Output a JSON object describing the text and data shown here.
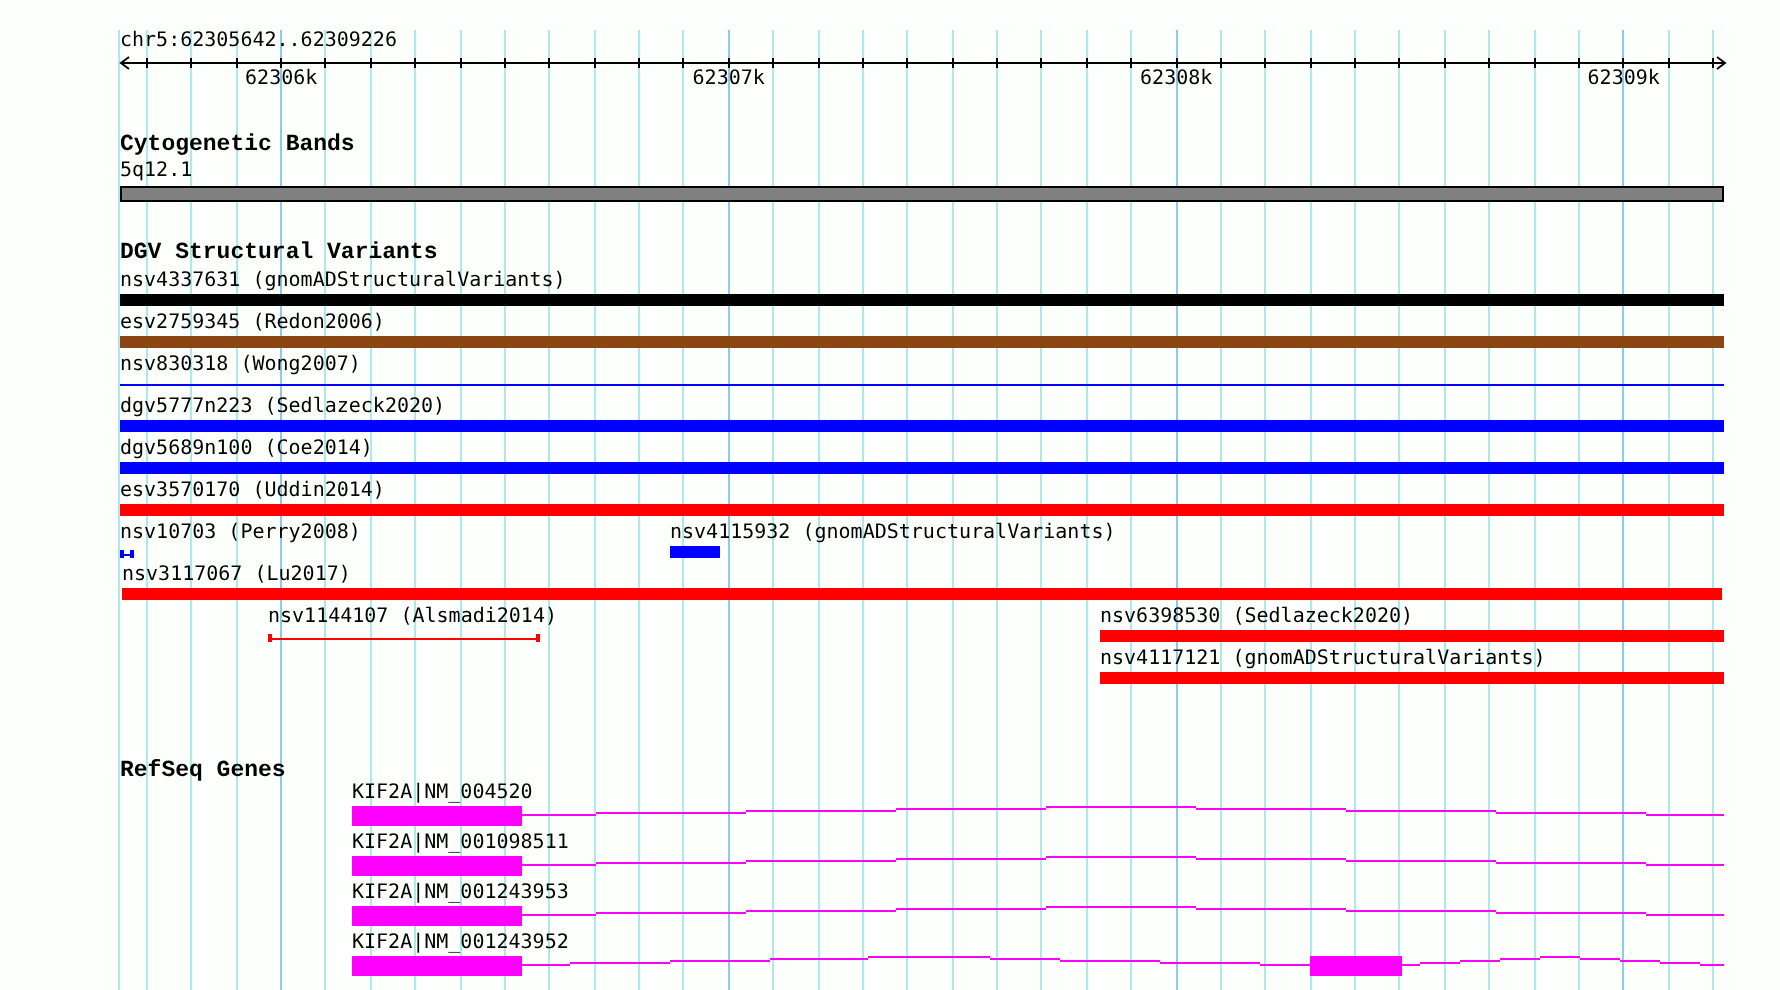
{
  "ruler": {
    "location": "chr5:62305642..62309226",
    "ticks": [
      "62306k",
      "62307k",
      "62308k",
      "62309k"
    ]
  },
  "cytogenetic_bands": {
    "title": "Cytogenetic Bands",
    "band": {
      "label": "5q12.1"
    }
  },
  "dgv_structural_variants": {
    "title": "DGV Structural Variants",
    "lanes": [
      {
        "features": [
          {
            "kind": "bar",
            "label": "nsv4337631 (gnomADStructuralVariants)",
            "color": "#000000"
          }
        ]
      },
      {
        "features": [
          {
            "kind": "bar",
            "label": "esv2759345 (Redon2006)",
            "color": "#8b4513"
          }
        ]
      },
      {
        "features": [
          {
            "kind": "line",
            "label": "nsv830318 (Wong2007)",
            "color": "#0000ff"
          }
        ]
      },
      {
        "features": [
          {
            "kind": "bar",
            "label": "dgv5777n223 (Sedlazeck2020)",
            "color": "#0000ff"
          }
        ]
      },
      {
        "features": [
          {
            "kind": "bar",
            "label": "dgv5689n100 (Coe2014)",
            "color": "#0000ff"
          }
        ]
      },
      {
        "features": [
          {
            "kind": "bar",
            "label": "esv3570170 (Uddin2014)",
            "color": "#ff0000"
          }
        ]
      },
      {
        "features": [
          {
            "kind": "span",
            "label": "nsv10703 (Perry2008)",
            "color": "#0000ff"
          },
          {
            "kind": "bar",
            "label": "nsv4115932 (gnomADStructuralVariants)",
            "color": "#0000ff"
          }
        ]
      },
      {
        "features": [
          {
            "kind": "bar",
            "label": "nsv3117067 (Lu2017)",
            "color": "#ff0000"
          }
        ]
      },
      {
        "features": [
          {
            "kind": "span",
            "label": "nsv1144107 (Alsmadi2014)",
            "color": "#ff0000"
          },
          {
            "kind": "bar",
            "label": "nsv6398530 (Sedlazeck2020)",
            "color": "#ff0000"
          }
        ]
      },
      {
        "features": [
          {
            "kind": "bar",
            "label": "nsv4117121 (gnomADStructuralVariants)",
            "color": "#ff0000"
          }
        ]
      }
    ]
  },
  "refseq_genes": {
    "title": "RefSeq Genes",
    "transcripts": [
      {
        "label": "KIF2A|NM_004520"
      },
      {
        "label": "KIF2A|NM_001098511"
      },
      {
        "label": "KIF2A|NM_001243953"
      },
      {
        "label": "KIF2A|NM_001243952"
      }
    ]
  }
}
